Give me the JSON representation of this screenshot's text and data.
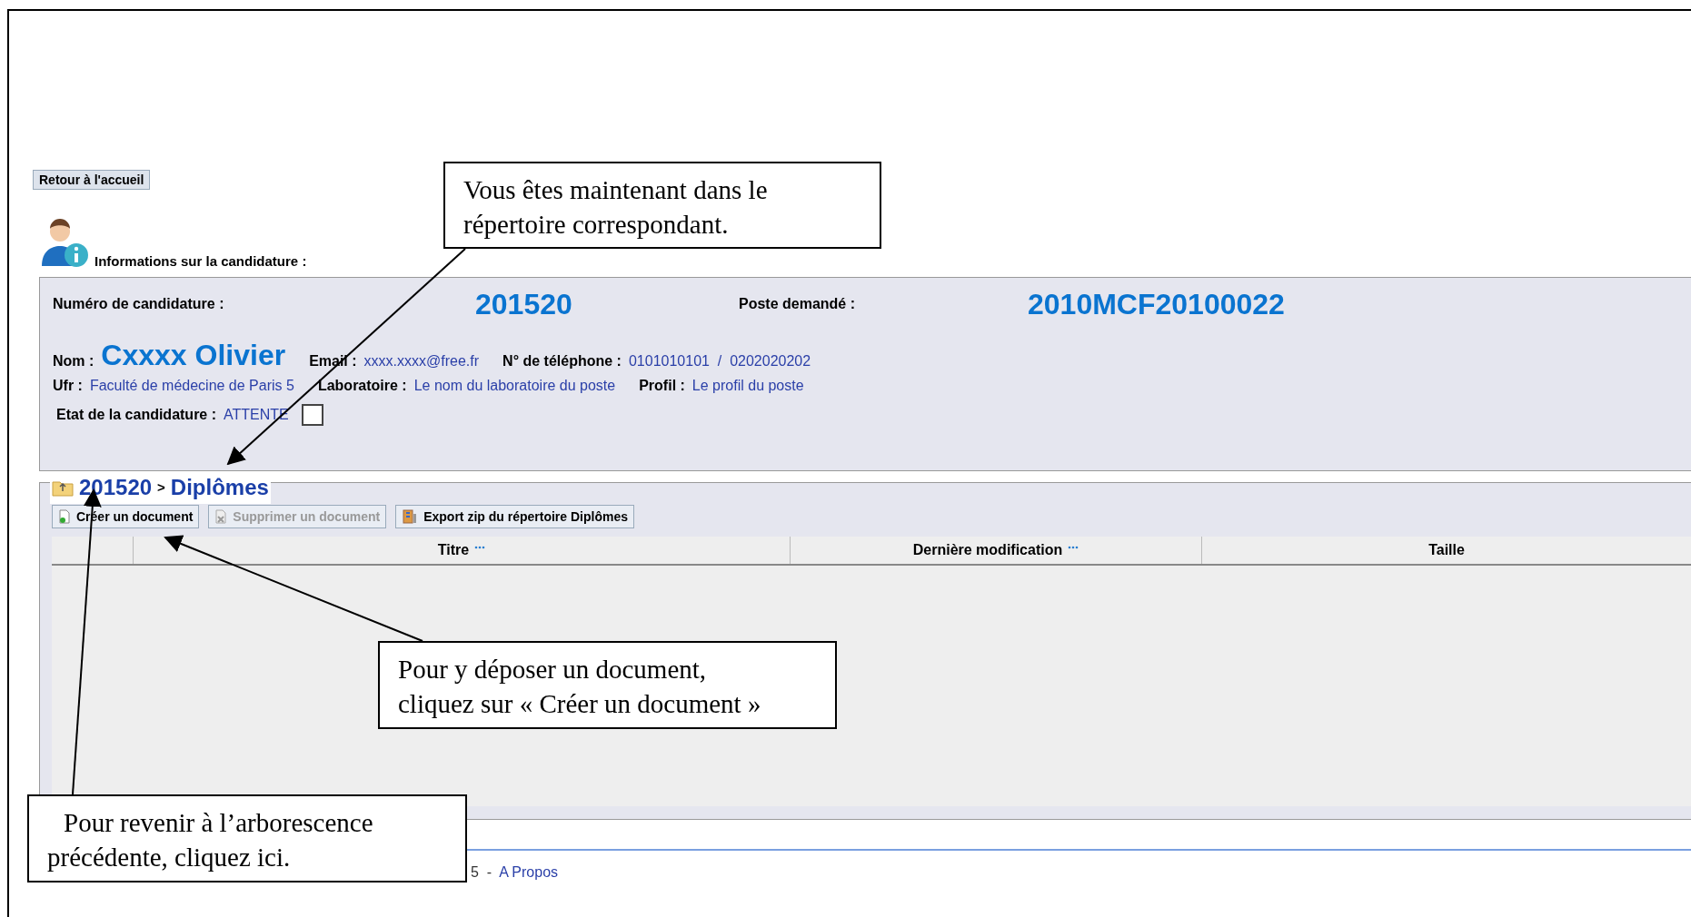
{
  "back_button": "Retour à l'accueil",
  "info_heading": "Informations sur la candidature :",
  "info": {
    "number_label": "Numéro de candidature :",
    "number": "201520",
    "post_label": "Poste demandé :",
    "post": "2010MCF20100022",
    "name_label": "Nom :",
    "name": "Cxxxx Olivier",
    "email_label": "Email :",
    "email": "xxxx.xxxx@free.fr",
    "phone_label": "N° de téléphone :",
    "phone": "0101010101  /  0202020202",
    "ufr_label": "Ufr :",
    "ufr": "Faculté de médecine de Paris 5",
    "lab_label": "Laboratoire :",
    "lab": "Le nom du laboratoire du poste",
    "profile_label": "Profil :",
    "profile": "Le profil du poste",
    "state_label": "Etat de la candidature :",
    "state": "ATTENTE",
    "state_checked": false
  },
  "folder": {
    "parent": "201520",
    "separator": ">",
    "name": "Diplômes"
  },
  "toolbar": [
    {
      "label": "Créer un document",
      "disabled": false,
      "kind": "create"
    },
    {
      "label": "Supprimer un document",
      "disabled": true,
      "kind": "delete"
    },
    {
      "label": "Export zip du répertoire Diplômes",
      "disabled": false,
      "kind": "export"
    }
  ],
  "table": {
    "columns": [
      {
        "label": "Titre",
        "sortable": true
      },
      {
        "label": "Dernière modification",
        "sortable": true
      },
      {
        "label": "Taille",
        "sortable": false
      }
    ]
  },
  "footer": {
    "text": "5  -",
    "link": "A Propos"
  },
  "callouts": [
    "Vous êtes maintenant dans le répertoire correspondant.",
    "Pour y déposer un document, cliquez sur « Créer un document »",
    "Pour revenir à l’arborescence précédente, cliquez ici."
  ]
}
